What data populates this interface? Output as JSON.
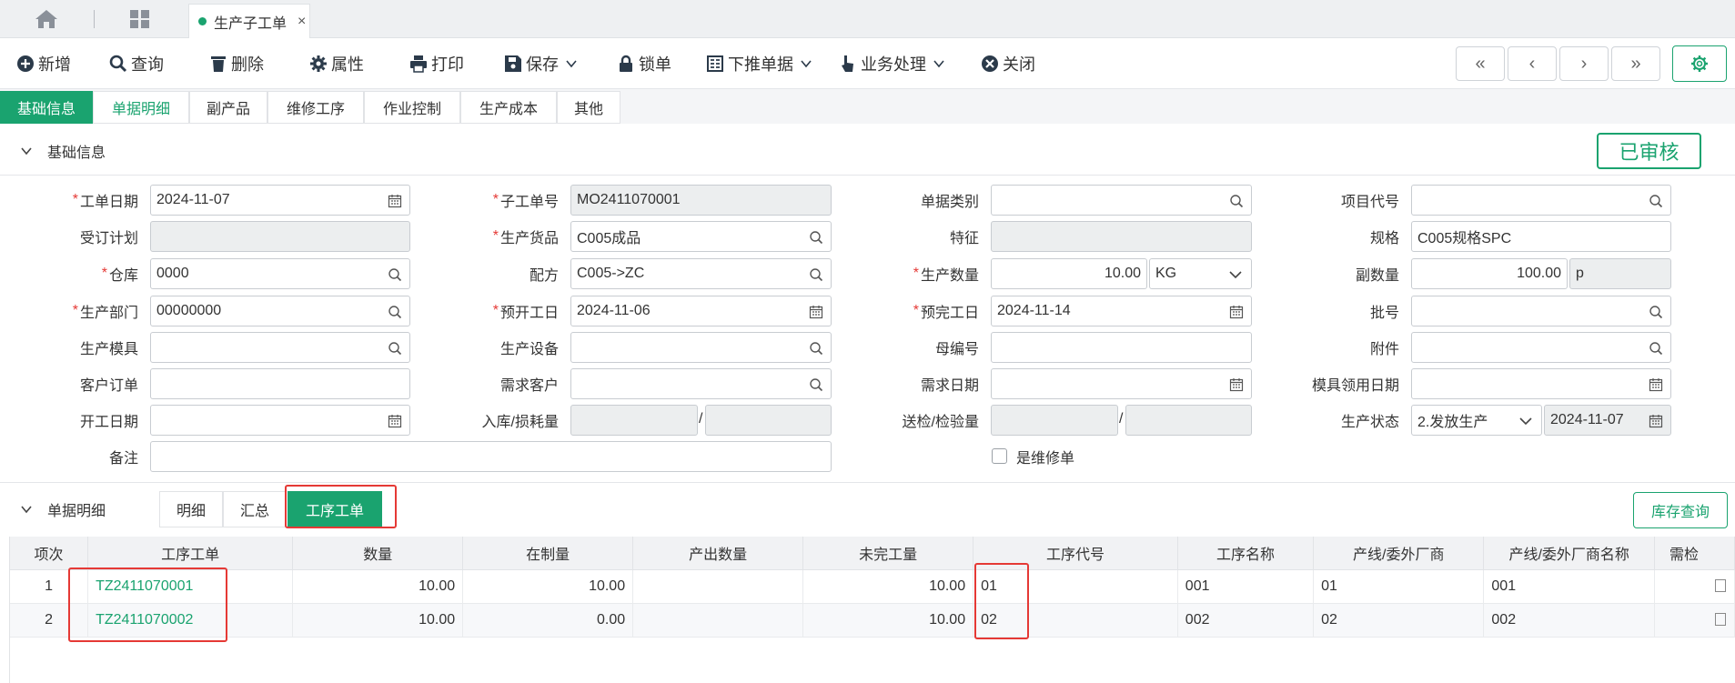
{
  "topbar": {
    "doc_tab": "生产子工单",
    "close": "×"
  },
  "toolbar": {
    "buttons": [
      {
        "label": "新增",
        "icon": "plus-circle-icon"
      },
      {
        "label": "查询",
        "icon": "search-icon"
      },
      {
        "label": "删除",
        "icon": "trash-icon"
      },
      {
        "label": "属性",
        "icon": "gear-icon"
      },
      {
        "label": "打印",
        "icon": "printer-icon"
      },
      {
        "label": "保存",
        "icon": "save-icon"
      },
      {
        "label": "锁单",
        "icon": "lock-icon"
      },
      {
        "label": "下推单据",
        "icon": "document-icon"
      },
      {
        "label": "业务处理",
        "icon": "hand-pointer-icon"
      },
      {
        "label": "关闭",
        "icon": "close-circle-icon"
      }
    ],
    "nav": [
      "«",
      "‹",
      "›",
      "»"
    ]
  },
  "page_tabs": [
    "基础信息",
    "单据明细",
    "副产品",
    "维修工序",
    "作业控制",
    "生产成本",
    "其他"
  ],
  "basic": {
    "title": "基础信息",
    "status": "已审核",
    "fields": {
      "work_date": {
        "label": "工单日期",
        "value": "2024-11-07"
      },
      "sub_no": {
        "label": "子工单号",
        "value": "MO2411070001"
      },
      "doc_type": {
        "label": "单据类别",
        "value": ""
      },
      "project_code": {
        "label": "项目代号",
        "value": ""
      },
      "order_plan": {
        "label": "受订计划",
        "value": ""
      },
      "product": {
        "label": "生产货品",
        "value": "C005成品"
      },
      "feature": {
        "label": "特征",
        "value": ""
      },
      "spec": {
        "label": "规格",
        "value": "C005规格SPC"
      },
      "warehouse": {
        "label": "仓库",
        "value": "0000"
      },
      "formula": {
        "label": "配方",
        "value": "C005->ZC"
      },
      "qty": {
        "label": "生产数量",
        "value": "10.00",
        "unit": "KG"
      },
      "sub_qty": {
        "label": "副数量",
        "value": "100.00",
        "unit": "p"
      },
      "dept": {
        "label": "生产部门",
        "value": "00000000"
      },
      "plan_start": {
        "label": "预开工日",
        "value": "2024-11-06"
      },
      "plan_end": {
        "label": "预完工日",
        "value": "2024-11-14"
      },
      "batch": {
        "label": "批号",
        "value": ""
      },
      "mold": {
        "label": "生产模具",
        "value": ""
      },
      "equipment": {
        "label": "生产设备",
        "value": ""
      },
      "parent_no": {
        "label": "母编号",
        "value": ""
      },
      "attachment": {
        "label": "附件",
        "value": ""
      },
      "customer_order": {
        "label": "客户订单",
        "value": ""
      },
      "demand_customer": {
        "label": "需求客户",
        "value": ""
      },
      "demand_date": {
        "label": "需求日期",
        "value": ""
      },
      "mold_date": {
        "label": "模具领用日期",
        "value": ""
      },
      "start_date": {
        "label": "开工日期",
        "value": ""
      },
      "in_loss": {
        "label": "入库/损耗量",
        "value1": "",
        "value2": ""
      },
      "inspect": {
        "label": "送检/检验量",
        "value1": "",
        "value2": ""
      },
      "prod_status": {
        "label": "生产状态",
        "value": "2.发放生产",
        "date": "2024-11-07"
      },
      "remark": {
        "label": "备注",
        "value": ""
      },
      "repair": {
        "label": "是维修单"
      }
    },
    "slash": "/"
  },
  "detail": {
    "title": "单据明细",
    "sub_tabs": [
      "明细",
      "汇总",
      "工序工单"
    ],
    "stock_button": "库存查询",
    "columns": [
      "项次",
      "工序工单",
      "数量",
      "在制量",
      "产出数量",
      "未完工量",
      "工序代号",
      "工序名称",
      "产线/委外厂商",
      "产线/委外厂商名称",
      "需检"
    ],
    "rows": [
      {
        "no": "1",
        "order": "TZ2411070001",
        "qty": "10.00",
        "wip": "10.00",
        "output": "",
        "unfinished": "10.00",
        "proc_code": "01",
        "proc_name": "001",
        "line": "01",
        "line_name": "001"
      },
      {
        "no": "2",
        "order": "TZ2411070002",
        "qty": "10.00",
        "wip": "0.00",
        "output": "",
        "unfinished": "10.00",
        "proc_code": "02",
        "proc_name": "002",
        "line": "02",
        "line_name": "002"
      }
    ]
  },
  "colors": {
    "accent": "#1aa36f",
    "required": "#e53935",
    "highlight": "#e53935"
  }
}
